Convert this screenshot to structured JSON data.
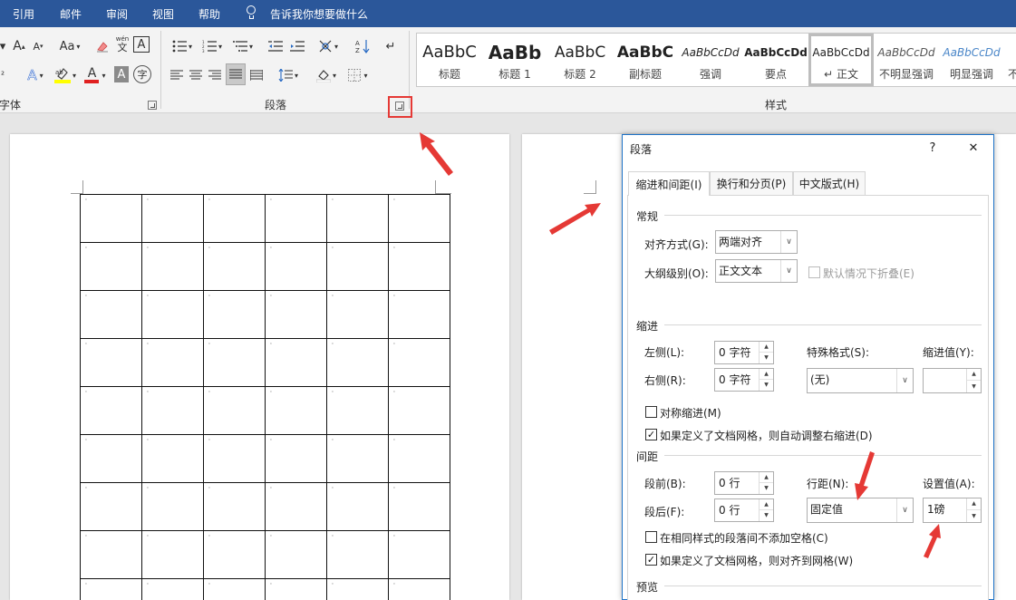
{
  "tabs": [
    "引用",
    "邮件",
    "审阅",
    "视图",
    "帮助"
  ],
  "tell_me": "告诉我你想要做什么",
  "ribbon": {
    "font_group_label": "字体",
    "paragraph_group_label": "段落",
    "styles_group_label": "样式",
    "font_buttons": {
      "grow": "A",
      "shrink": "A",
      "case": "Aa",
      "wen": "wén",
      "wen_char": "文",
      "border_char": "A",
      "text_effect": "A",
      "font_color": "A",
      "shading_char": "A",
      "circle_char": "字"
    },
    "styles": [
      {
        "sample": "AaBbC",
        "name": "标题"
      },
      {
        "sample": "AaBb",
        "name": "标题 1"
      },
      {
        "sample": "AaBbC",
        "name": "标题 2"
      },
      {
        "sample": "AaBbC",
        "name": "副标题"
      },
      {
        "sample": "AaBbCcDd",
        "name": "强调"
      },
      {
        "sample": "AaBbCcDd",
        "name": "要点"
      },
      {
        "sample": "AaBbCcDd",
        "name": "正文"
      },
      {
        "sample": "AaBbCcDd",
        "name": "不明显强调"
      },
      {
        "sample": "AaBbCcDd",
        "name": "明显强调"
      },
      {
        "sample": "",
        "name": "不"
      }
    ],
    "selected_style_prefix": "↵"
  },
  "colors": {
    "tabbar": "#2b579a",
    "highlight_yellow": "#ffff00",
    "font_red": "#e02020",
    "annotation_red": "#e53935",
    "intense_emphasis": "#4a86c8"
  },
  "document": {
    "rows": 9,
    "cols": 6,
    "cell_mark": "'"
  },
  "dialog": {
    "title": "段落",
    "help": "?",
    "close": "✕",
    "tabs": [
      "缩进和间距(I)",
      "换行和分页(P)",
      "中文版式(H)"
    ],
    "general": {
      "title": "常规",
      "alignment_label": "对齐方式(G):",
      "alignment_value": "两端对齐",
      "outline_label": "大纲级别(O):",
      "outline_value": "正文文本",
      "collapse_label": "默认情况下折叠(E)",
      "collapse_checked": false
    },
    "indent": {
      "title": "缩进",
      "left_label": "左侧(L):",
      "left_value": "0 字符",
      "right_label": "右侧(R):",
      "right_value": "0 字符",
      "special_label": "特殊格式(S):",
      "special_value": "(无)",
      "indent_by_label": "缩进值(Y):",
      "indent_by_value": "",
      "mirror_label": "对称缩进(M)",
      "mirror_checked": false,
      "auto_adjust_label": "如果定义了文档网格，则自动调整右缩进(D)",
      "auto_adjust_checked": true
    },
    "spacing": {
      "title": "间距",
      "before_label": "段前(B):",
      "before_value": "0 行",
      "after_label": "段后(F):",
      "after_value": "0 行",
      "line_spacing_label": "行距(N):",
      "line_spacing_value": "固定值",
      "at_label": "设置值(A):",
      "at_value": "1磅",
      "no_space_label": "在相同样式的段落间不添加空格(C)",
      "no_space_checked": false,
      "snap_grid_label": "如果定义了文档网格，则对齐到网格(W)",
      "snap_grid_checked": true
    },
    "preview": {
      "title": "预览"
    }
  }
}
